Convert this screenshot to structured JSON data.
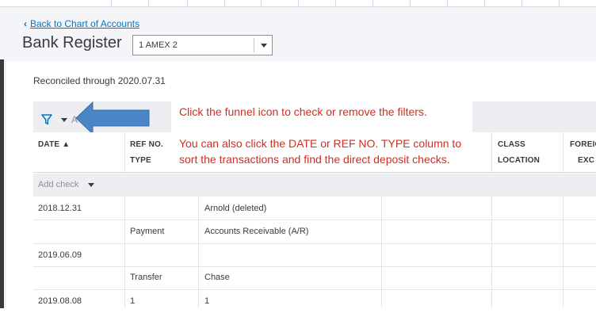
{
  "nav": {
    "back_label": "Back to Chart of Accounts",
    "back_chevron": "‹"
  },
  "page": {
    "title": "Bank Register",
    "account_selected": "1 AMEX 2",
    "reconciled_text": "Reconciled through 2020.07.31"
  },
  "filter": {
    "letter": "A",
    "funnel_icon": "funnel-icon",
    "caret_icon": "caret-down-icon"
  },
  "annotations": {
    "line1": "Click the funnel icon to check or remove the filters.",
    "line2": "You can also click the DATE or REF NO. TYPE column to",
    "line3": "sort the transactions and find the direct deposit checks.",
    "color": "#d52b1e",
    "arrow_color": "#4a86c5"
  },
  "table": {
    "headers": {
      "date": "DATE ▲",
      "ref_no": "REF NO.",
      "type": "TYPE",
      "class": "CLASS",
      "location": "LOCATION",
      "foreign": "FOREIG",
      "exch": "EXC"
    },
    "add_check": "Add check",
    "rows": [
      {
        "date": "2018.12.31",
        "ref": "",
        "payee": "Arnold (deleted)"
      },
      {
        "date": "",
        "ref": "Payment",
        "payee": "Accounts Receivable (A/R)"
      },
      {
        "date": "2019.06.09",
        "ref": "",
        "payee": ""
      },
      {
        "date": "",
        "ref": "Transfer",
        "payee": "Chase"
      },
      {
        "date": "2019.08.08",
        "ref": "1",
        "payee": "1"
      }
    ]
  },
  "colors": {
    "link": "#0077c5",
    "accent": "#0077c5",
    "page_bg": "#f4f5f8"
  }
}
